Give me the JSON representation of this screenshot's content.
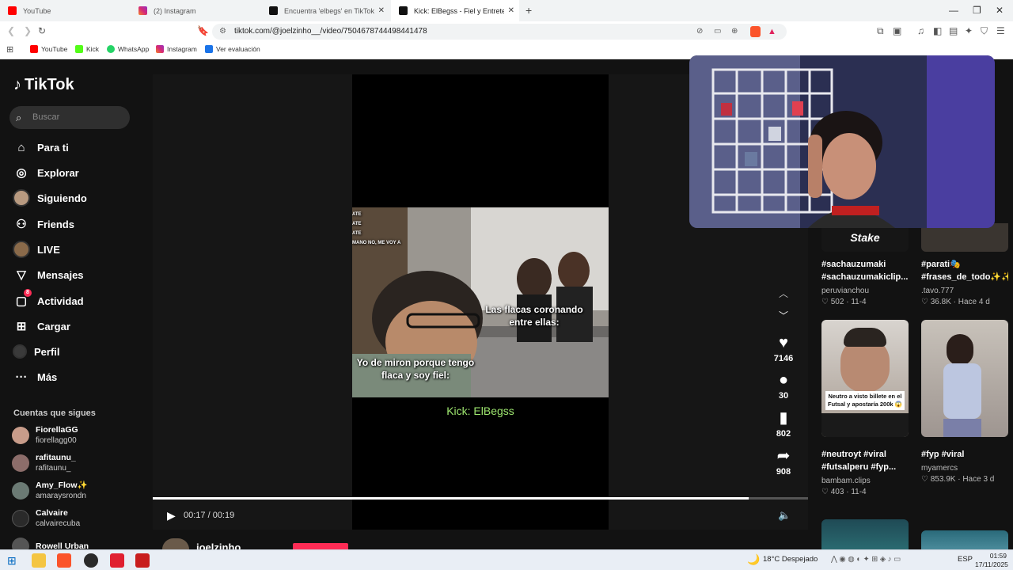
{
  "browser": {
    "tabs": [
      {
        "label": "YouTube",
        "color": "#ff0000"
      },
      {
        "label": "(2) Instagram",
        "color": "#d62976"
      },
      {
        "label": "Encuentra 'elbegs' en TikTok | Bu",
        "color": "#000000"
      },
      {
        "label": "Kick: ElBegss - Fiel y Entretenido",
        "color": "#000000"
      }
    ],
    "new_tab": "+",
    "url": "tiktok.com/@joelzinho__/video/7504678744498441478",
    "bookmarks": [
      {
        "label": "YouTube",
        "color": "#ff0000"
      },
      {
        "label": "Kick",
        "color": "#53fc18"
      },
      {
        "label": "WhatsApp",
        "color": "#25d366"
      },
      {
        "label": "Instagram",
        "color": "#d62976"
      },
      {
        "label": "Ver evaluación",
        "color": "#1a73e8"
      }
    ]
  },
  "sidebar": {
    "logo": "TikTok",
    "search_placeholder": "Buscar",
    "nav": [
      {
        "label": "Para ti",
        "icon": "home-icon"
      },
      {
        "label": "Explorar",
        "icon": "compass-icon"
      },
      {
        "label": "Siguiendo",
        "icon": "following-avatar"
      },
      {
        "label": "Friends",
        "icon": "friends-icon"
      },
      {
        "label": "LIVE",
        "icon": "live-avatar"
      },
      {
        "label": "Mensajes",
        "icon": "send-icon"
      },
      {
        "label": "Actividad",
        "icon": "inbox-icon",
        "badge": "8"
      },
      {
        "label": "Cargar",
        "icon": "upload-icon"
      },
      {
        "label": "Perfil",
        "icon": "profile-avatar"
      },
      {
        "label": "Más",
        "icon": "more-icon"
      }
    ],
    "following_title": "Cuentas que sigues",
    "following": [
      {
        "name": "FiorellaGG",
        "user": "fiorellagg00"
      },
      {
        "name": "rafitaunu_",
        "user": "rafitaunu_"
      },
      {
        "name": "Amy_Flow✨",
        "user": "amaraysrondn"
      },
      {
        "name": "Calvaire",
        "user": "calvairecuba"
      },
      {
        "name": "Rowell Urban",
        "user": ""
      }
    ]
  },
  "video": {
    "subtitle_right": "Las flacas coronando entre ellas:",
    "subtitle_left": "Yo de miron porque tengo flaca y soy fiel:",
    "overlay_lines": [
      "ATE",
      "ATE",
      "ATE",
      "MANO NO, ME VOY A"
    ],
    "kick_caption": "Kick: ElBegss",
    "time": "00:17 / 00:19",
    "progress": 0.91,
    "likes": "7146",
    "comments": "30",
    "saves": "802",
    "shares": "908",
    "author": "joelzinho"
  },
  "grid": [
    {
      "tags": "#sachauzumaki #sachauzumakiclip...",
      "user": "peruvianchou",
      "stat": "502 · 11-4",
      "thumb_text": "Stake"
    },
    {
      "tags": "#parati🎭 #frases_de_todo✨✨...",
      "user": ".tavo.777",
      "stat": "36.8K · Hace 4 d",
      "thumb_text": ""
    },
    {
      "tags": "#neutroyt #viral #futsalperu #fyp...",
      "user": "bambam.clips",
      "stat": "403 · 11-4",
      "thumb_text": "Neutro a visto billete en el Futsal y apostaría 200k 😱"
    },
    {
      "tags": "#fyp #viral",
      "user": "myamercs",
      "stat": "853.9K · Hace 3 d",
      "thumb_text": ""
    }
  ],
  "taskbar": {
    "weather": "18°C  Despejado",
    "lang": "ESP",
    "time": "01:59",
    "date": "17/11/2025"
  }
}
